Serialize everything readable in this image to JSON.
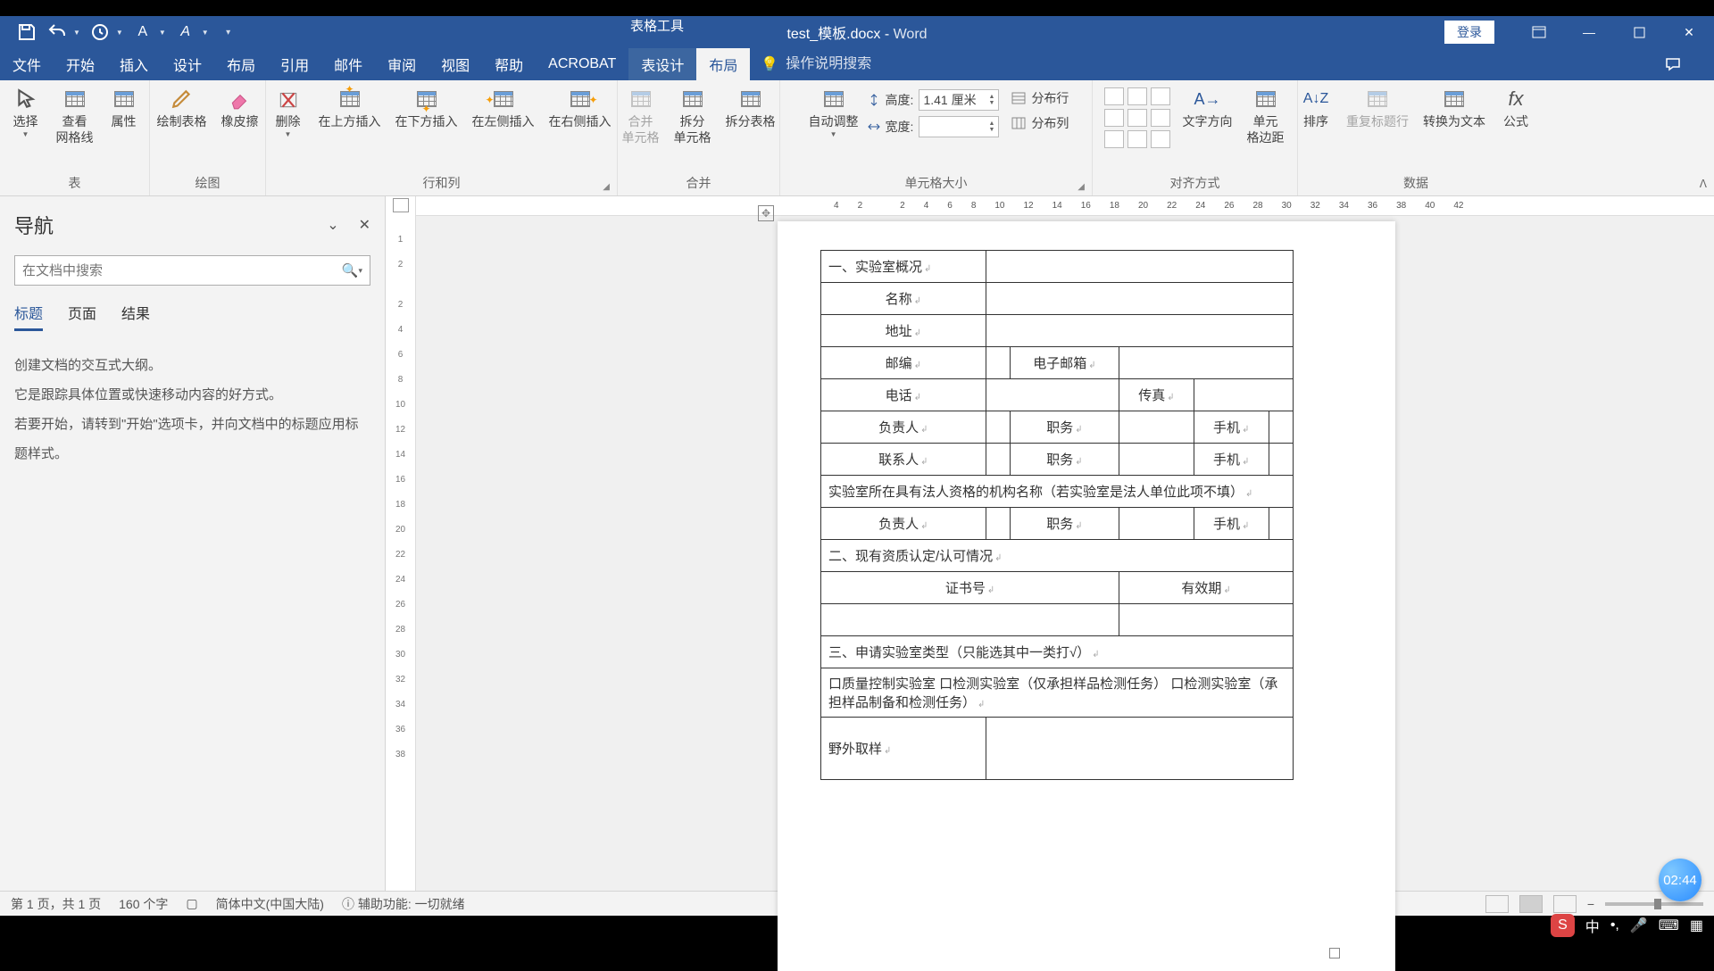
{
  "titlebar": {
    "context_tool": "表格工具",
    "doc_name": "test_模板.docx",
    "app_name": "Word",
    "login": "登录"
  },
  "menu": {
    "file": "文件",
    "home": "开始",
    "insert": "插入",
    "design": "设计",
    "layout1": "布局",
    "ref": "引用",
    "mail": "邮件",
    "review": "审阅",
    "view": "视图",
    "help": "帮助",
    "acrobat": "ACROBAT",
    "table_design": "表设计",
    "table_layout": "布局",
    "tell_me": "操作说明搜索"
  },
  "ribbon": {
    "select": "选择",
    "gridlines": "查看\n网格线",
    "properties": "属性",
    "g_table": "表",
    "draw": "绘制表格",
    "eraser": "橡皮擦",
    "g_draw": "绘图",
    "delete": "删除",
    "ins_above": "在上方插入",
    "ins_below": "在下方插入",
    "ins_left": "在左侧插入",
    "ins_right": "在右侧插入",
    "g_rowcol": "行和列",
    "merge": "合并\n单元格",
    "split": "拆分\n单元格",
    "split_tbl": "拆分表格",
    "g_merge": "合并",
    "autofit": "自动调整",
    "height": "高度:",
    "height_val": "1.41 厘米",
    "width": "宽度:",
    "width_val": "",
    "dist_rows": "分布行",
    "dist_cols": "分布列",
    "g_size": "单元格大小",
    "text_dir": "文字方向",
    "margins": "单元\n格边距",
    "g_align": "对齐方式",
    "sort": "排序",
    "repeat": "重复标题行",
    "to_text": "转换为文本",
    "formula": "公式",
    "g_data": "数据"
  },
  "nav": {
    "title": "导航",
    "search_placeholder": "在文档中搜索",
    "tab_head": "标题",
    "tab_page": "页面",
    "tab_result": "结果",
    "p1": "创建文档的交互式大纲。",
    "p2": "它是跟踪具体位置或快速移动内容的好方式。",
    "p3": "若要开始，请转到\"开始\"选项卡，并向文档中的标题应用标题样式。"
  },
  "ruler": {
    "h": [
      "4",
      "2",
      "",
      "2",
      "4",
      "6",
      "8",
      "10",
      "12",
      "14",
      "16",
      "18",
      "20",
      "22",
      "24",
      "26",
      "28",
      "30",
      "32",
      "34",
      "36",
      "38",
      "40",
      "42"
    ],
    "v_left": [
      "",
      "1",
      "2",
      "",
      "2",
      "4",
      "6",
      "8",
      "10",
      "12",
      "14",
      "16",
      "18",
      "20",
      "22",
      "24",
      "26",
      "28",
      "30",
      "32",
      "34",
      "36",
      "38"
    ]
  },
  "table": {
    "r1": "一、实验室概况",
    "name": "名称",
    "addr": "地址",
    "zip": "邮编",
    "email": "电子邮箱",
    "tel": "电话",
    "fax": "传真",
    "owner": "负责人",
    "duty": "职务",
    "mobile": "手机",
    "contact": "联系人",
    "org": "实验室所在具有法人资格的机构名称（若实验室是法人单位此项不填）",
    "r2": "二、现有资质认定/认可情况",
    "cert": "证书号",
    "valid": "有效期",
    "r3": "三、申请实验室类型（只能选其中一类打√）",
    "opts": "口质量控制实验室  口检测实验室（仅承担样品检测任务）  口检测实验室（承担样品制备和检测任务）",
    "field": "野外取样"
  },
  "status": {
    "page": "第 1 页，共 1 页",
    "words": "160 个字",
    "lang": "简体中文(中国大陆)",
    "a11y": "辅助功能: 一切就绪",
    "zoom": "100%"
  },
  "taskbar": {
    "ime": "中",
    "clock": "02:44"
  }
}
